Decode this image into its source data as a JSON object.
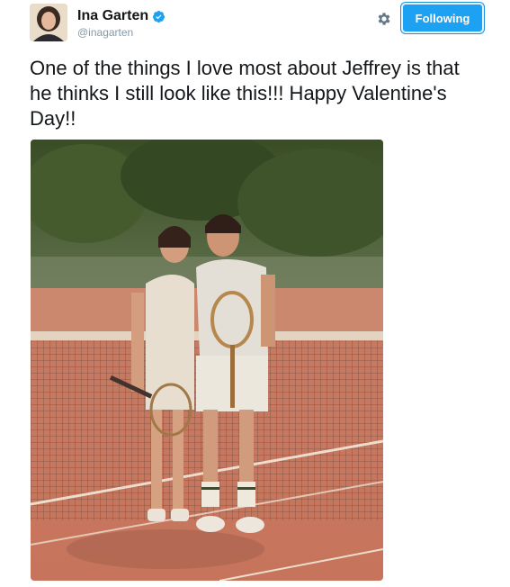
{
  "tweet": {
    "display_name": "Ina Garten",
    "handle": "@inagarten",
    "text": "One of the things I love most about Jeffrey is that he thinks I still look like this!!! Happy Valentine's Day!!",
    "follow_label": "Following"
  },
  "icons": {
    "verified": "verified-badge-icon",
    "settings": "gear-icon"
  },
  "colors": {
    "accent": "#1da1f2",
    "text": "#14171a",
    "secondary_text": "#8899a6"
  }
}
